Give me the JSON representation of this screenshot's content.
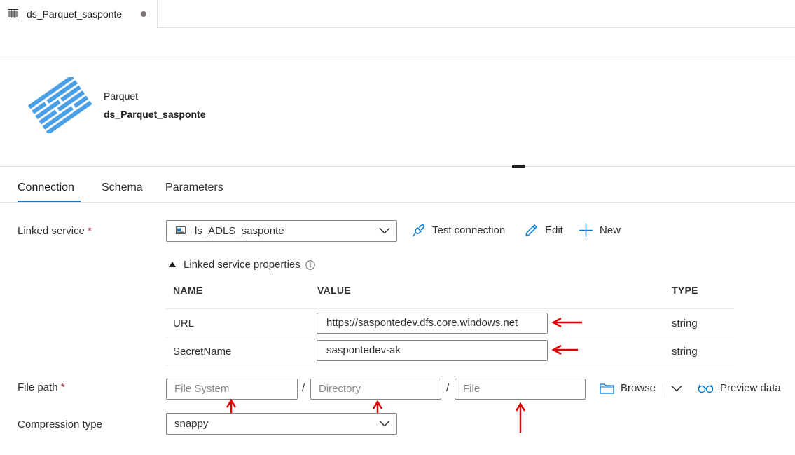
{
  "tab": {
    "title": "ds_Parquet_sasponte",
    "icon": "table-grid-icon",
    "unsaved": true
  },
  "header": {
    "type_label": "Parquet",
    "dataset_name": "ds_Parquet_sasponte",
    "icon": "parquet-dataset-icon"
  },
  "section_tabs": [
    {
      "label": "Connection",
      "active": true
    },
    {
      "label": "Schema",
      "active": false
    },
    {
      "label": "Parameters",
      "active": false
    }
  ],
  "linked_service": {
    "label": "Linked service",
    "required_mark": "*",
    "selected": "ls_ADLS_sasponte",
    "actions": {
      "test_connection": "Test connection",
      "edit": "Edit",
      "new": "New"
    }
  },
  "linked_service_properties": {
    "title": "Linked service properties",
    "columns": {
      "name": "NAME",
      "value": "VALUE",
      "type": "TYPE"
    },
    "rows": [
      {
        "name": "URL",
        "value": "https://saspontedev.dfs.core.windows.net",
        "type": "string"
      },
      {
        "name": "SecretName",
        "value": "saspontedev-ak",
        "type": "string"
      }
    ]
  },
  "file_path": {
    "label": "File path",
    "required_mark": "*",
    "file_system_placeholder": "File System",
    "directory_placeholder": "Directory",
    "file_placeholder": "File",
    "separator": "/",
    "browse": "Browse",
    "preview": "Preview data"
  },
  "compression": {
    "label": "Compression type",
    "selected": "snappy"
  },
  "colors": {
    "accent": "#0078d4",
    "annotation_arrow": "#e00000",
    "parquet_icon": "#4aa0e6"
  }
}
